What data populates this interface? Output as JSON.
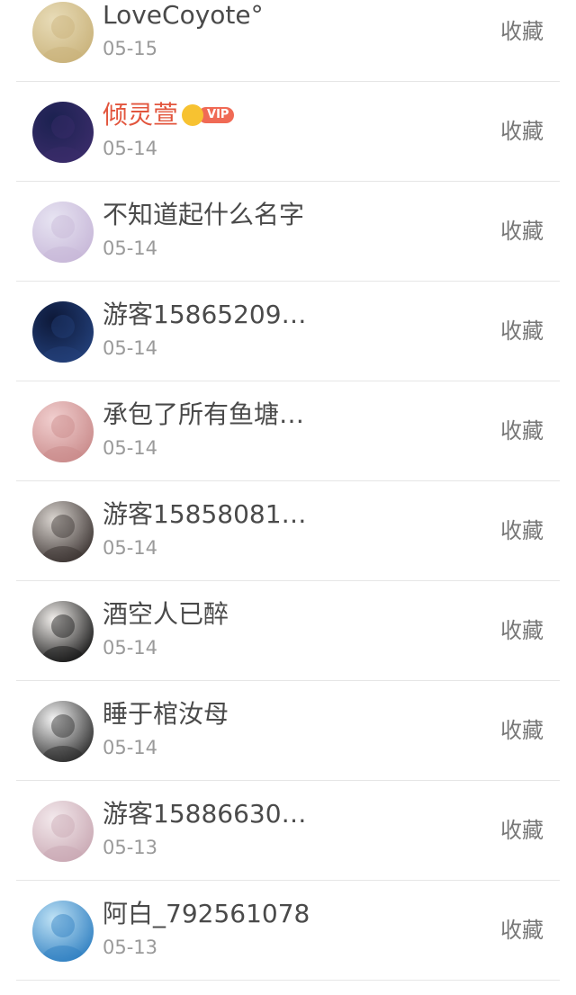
{
  "favorite_label": "收藏",
  "vip_label": "VIP",
  "users": [
    {
      "name": "LoveCoyote°",
      "date": "05-15",
      "vip": false,
      "avatar": "blonde-character-avatar",
      "colors": [
        "#e8dcb8",
        "#c9b27a"
      ]
    },
    {
      "name": "倾灵萱",
      "date": "05-14",
      "vip": true,
      "avatar": "boy-dark-avatar",
      "colors": [
        "#1b2150",
        "#3a2c6a"
      ]
    },
    {
      "name": "不知道起什么名字",
      "date": "05-14",
      "vip": false,
      "avatar": "anime-girl-avatar",
      "colors": [
        "#e7e4f2",
        "#c7b7d8"
      ]
    },
    {
      "name": "游客15865209…",
      "date": "05-14",
      "vip": false,
      "avatar": "night-sky-avatar",
      "colors": [
        "#0d1838",
        "#23407a"
      ]
    },
    {
      "name": "承包了所有鱼塘…",
      "date": "05-14",
      "vip": false,
      "avatar": "pink-flower-avatar",
      "colors": [
        "#f1cfcf",
        "#c98a8a"
      ]
    },
    {
      "name": "游客15858081…",
      "date": "05-14",
      "vip": false,
      "avatar": "boy-portrait-avatar",
      "colors": [
        "#d9d4cf",
        "#3a3230"
      ]
    },
    {
      "name": "酒空人已醉",
      "date": "05-14",
      "vip": false,
      "avatar": "girl-black-hair-avatar",
      "colors": [
        "#f2efec",
        "#151515"
      ]
    },
    {
      "name": "睡于棺汝母",
      "date": "05-14",
      "vip": false,
      "avatar": "manga-sketch-avatar",
      "colors": [
        "#f4f4f4",
        "#2a2a2a"
      ]
    },
    {
      "name": "游客15886630…",
      "date": "05-13",
      "vip": false,
      "avatar": "soft-girl-avatar",
      "colors": [
        "#f3e9ec",
        "#c9a8b3"
      ]
    },
    {
      "name": "阿白_792561078",
      "date": "05-13",
      "vip": false,
      "avatar": "blue-anime-avatar",
      "colors": [
        "#bfe2f5",
        "#2f7fc1"
      ]
    }
  ]
}
